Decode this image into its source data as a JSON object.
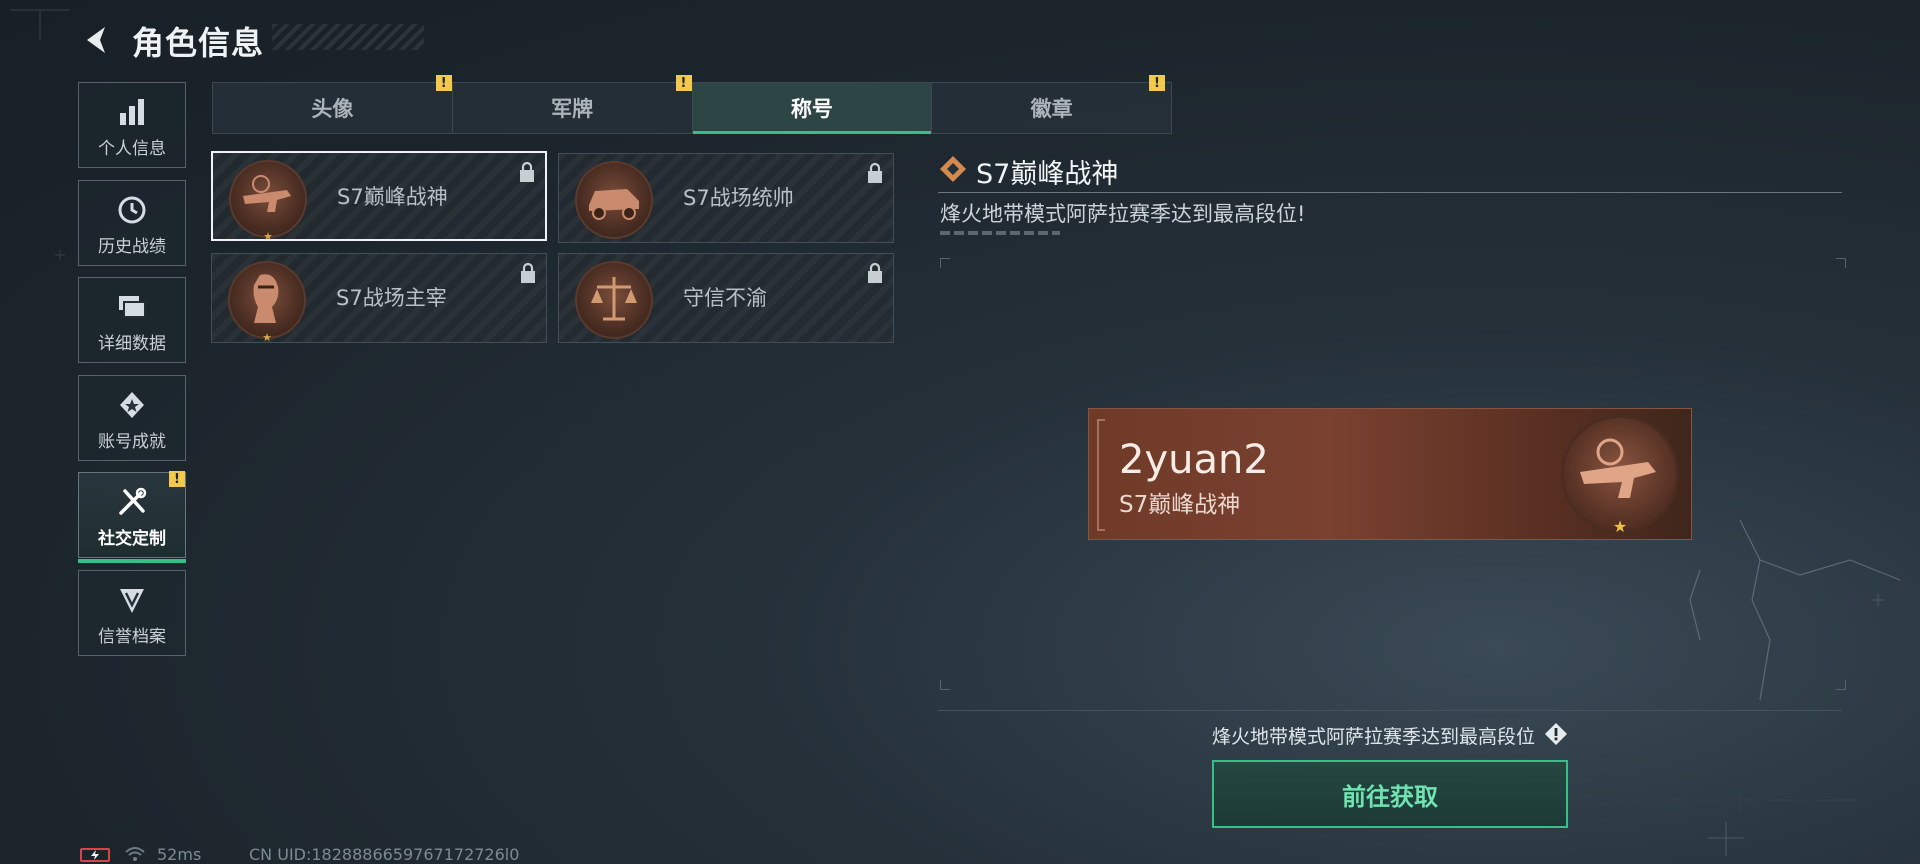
{
  "header": {
    "title": "角色信息",
    "back_icon": "back-arrow-icon"
  },
  "sidebar": {
    "items": [
      {
        "label": "个人信息",
        "icon": "bar-chart-icon",
        "active": false
      },
      {
        "label": "历史战绩",
        "icon": "history-clock-icon",
        "active": false
      },
      {
        "label": "详细数据",
        "icon": "folders-icon",
        "active": false
      },
      {
        "label": "账号成就",
        "icon": "achievement-badge-icon",
        "active": false
      },
      {
        "label": "社交定制",
        "icon": "tools-icon",
        "active": true,
        "alert": "!"
      },
      {
        "label": "信誉档案",
        "icon": "credit-shield-icon",
        "active": false
      }
    ]
  },
  "tabs": [
    {
      "label": "头像",
      "alert": "!"
    },
    {
      "label": "军牌",
      "alert": "!"
    },
    {
      "label": "称号",
      "active": true
    },
    {
      "label": "徽章",
      "alert": "!"
    }
  ],
  "titles": [
    {
      "name": "S7巅峰战神",
      "selected": true,
      "locked": true,
      "emblem": "rifle-emblem-icon"
    },
    {
      "name": "S7战场统帅",
      "selected": false,
      "locked": true,
      "emblem": "vehicle-emblem-icon"
    },
    {
      "name": "S7战场主宰",
      "selected": false,
      "locked": true,
      "emblem": "soldier-emblem-icon"
    },
    {
      "name": "守信不渝",
      "selected": false,
      "locked": true,
      "emblem": "scales-emblem-icon"
    }
  ],
  "detail": {
    "title": "S7巅峰战神",
    "description": "烽火地带模式阿萨拉赛季达到最高段位!",
    "preview": {
      "player_name": "2yuan2",
      "title": "S7巅峰战神"
    },
    "condition": "烽火地带模式阿萨拉赛季达到最高段位",
    "action_label": "前往获取"
  },
  "status": {
    "ping": "52ms",
    "uid": "CN UID:1828886659767172726l0"
  },
  "colors": {
    "accent": "#35c08a",
    "alert": "#f2c94c",
    "title_bronze": "#7a4130"
  }
}
